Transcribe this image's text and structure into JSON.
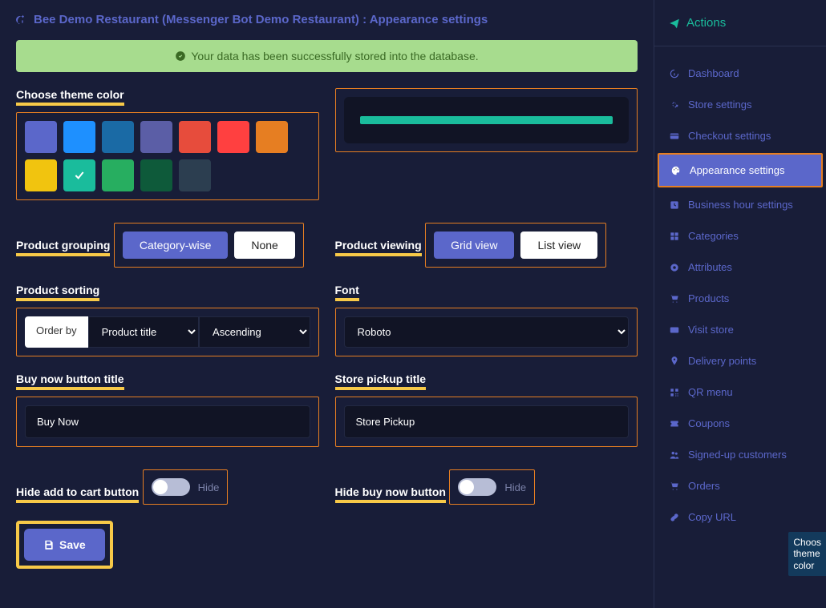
{
  "header": {
    "title": "Bee Demo Restaurant (Messenger Bot Demo Restaurant) : Appearance settings"
  },
  "alert": {
    "message": "Your data has been successfully stored into the database."
  },
  "labels": {
    "choose_theme_color": "Choose theme color",
    "product_grouping": "Product grouping",
    "product_viewing": "Product viewing",
    "product_sorting": "Product sorting",
    "font": "Font",
    "buy_now_button_title": "Buy now button title",
    "store_pickup_title": "Store pickup title",
    "hide_add_to_cart": "Hide add to cart button",
    "hide_buy_now": "Hide buy now button"
  },
  "theme_colors": [
    {
      "hex": "#5b67ca",
      "selected": false
    },
    {
      "hex": "#1e90ff",
      "selected": false
    },
    {
      "hex": "#1a6aa5",
      "selected": false
    },
    {
      "hex": "#5b5ea6",
      "selected": false
    },
    {
      "hex": "#e74c3c",
      "selected": false
    },
    {
      "hex": "#ff4040",
      "selected": false
    },
    {
      "hex": "#e67e22",
      "selected": false
    },
    {
      "hex": "#f1c40f",
      "selected": false
    },
    {
      "hex": "#1abc9c",
      "selected": true
    },
    {
      "hex": "#27ae60",
      "selected": false
    },
    {
      "hex": "#0e5a3a",
      "selected": false
    },
    {
      "hex": "#2c3e50",
      "selected": false
    }
  ],
  "grouping": {
    "category_wise": "Category-wise",
    "none": "None",
    "active": "category_wise"
  },
  "viewing": {
    "grid": "Grid view",
    "list": "List view",
    "active": "grid"
  },
  "sorting": {
    "orderby_label": "Order by",
    "field": "Product title",
    "direction": "Ascending"
  },
  "font": {
    "value": "Roboto"
  },
  "inputs": {
    "buy_now_value": "Buy Now",
    "store_pickup_value": "Store Pickup"
  },
  "toggles": {
    "hide_label": "Hide"
  },
  "save_label": "Save",
  "sidebar": {
    "actions_label": "Actions",
    "items": [
      {
        "label": "Dashboard",
        "icon": "gauge"
      },
      {
        "label": "Store settings",
        "icon": "gear"
      },
      {
        "label": "Checkout settings",
        "icon": "card"
      },
      {
        "label": "Appearance settings",
        "icon": "palette",
        "active": true
      },
      {
        "label": "Business hour settings",
        "icon": "clock"
      },
      {
        "label": "Categories",
        "icon": "grid"
      },
      {
        "label": "Attributes",
        "icon": "tag"
      },
      {
        "label": "Products",
        "icon": "cart"
      },
      {
        "label": "Visit store",
        "icon": "card2"
      },
      {
        "label": "Delivery points",
        "icon": "pin"
      },
      {
        "label": "QR menu",
        "icon": "qr"
      },
      {
        "label": "Coupons",
        "icon": "ticket"
      },
      {
        "label": "Signed-up customers",
        "icon": "users"
      },
      {
        "label": "Orders",
        "icon": "cart2"
      },
      {
        "label": "Copy URL",
        "icon": "link"
      }
    ]
  },
  "tooltip": "Choos\ntheme\ncolor"
}
